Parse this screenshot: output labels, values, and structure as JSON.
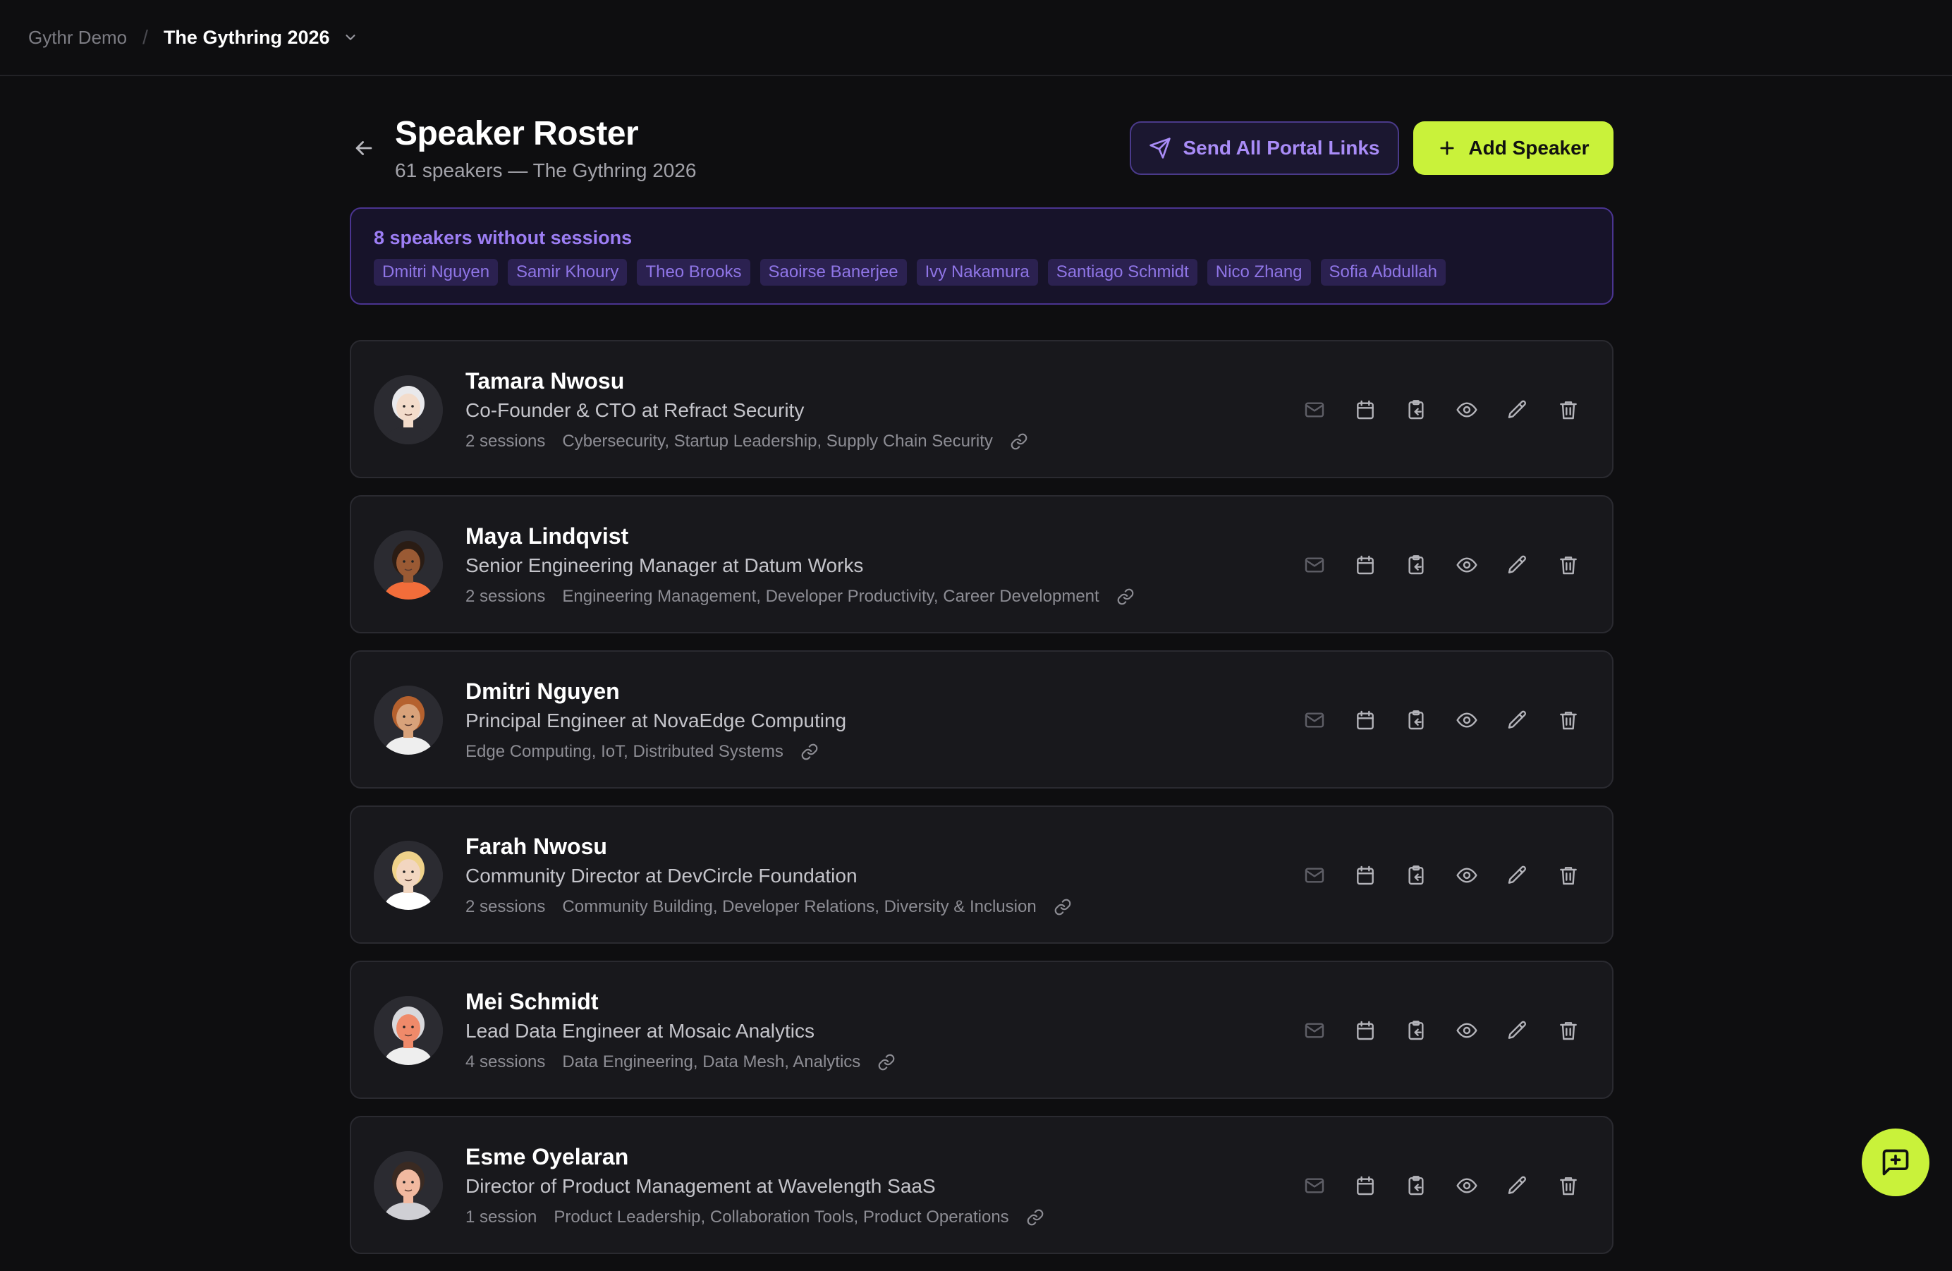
{
  "breadcrumb": {
    "org": "Gythr Demo",
    "separator": "/",
    "event": "The Gythring 2026"
  },
  "header": {
    "title": "Speaker Roster",
    "subtitle": "61 speakers — The Gythring 2026",
    "send_label": "Send All Portal Links",
    "add_label": "Add Speaker"
  },
  "notice": {
    "title": "8 speakers without sessions",
    "names": [
      "Dmitri Nguyen",
      "Samir Khoury",
      "Theo Brooks",
      "Saoirse Banerjee",
      "Ivy Nakamura",
      "Santiago Schmidt",
      "Nico Zhang",
      "Sofia Abdullah"
    ]
  },
  "speakers": [
    {
      "name": "Tamara Nwosu",
      "title": "Co-Founder & CTO at Refract Security",
      "sessions": "2 sessions",
      "topics": "Cybersecurity, Startup Leadership, Supply Chain Security",
      "avatar": {
        "skin": "#f3dccb",
        "hair": "#e9e9ec",
        "shirt": "#2b2b31"
      }
    },
    {
      "name": "Maya Lindqvist",
      "title": "Senior Engineering Manager at Datum Works",
      "sessions": "2 sessions",
      "topics": "Engineering Management, Developer Productivity, Career Development",
      "avatar": {
        "skin": "#9a5a34",
        "hair": "#2a1c14",
        "shirt": "#f26d3a"
      }
    },
    {
      "name": "Dmitri Nguyen",
      "title": "Principal Engineer at NovaEdge Computing",
      "sessions": "",
      "topics": "Edge Computing, IoT, Distributed Systems",
      "avatar": {
        "skin": "#d8a27a",
        "hair": "#b5612e",
        "shirt": "#eeeeee"
      }
    },
    {
      "name": "Farah Nwosu",
      "title": "Community Director at DevCircle Foundation",
      "sessions": "2 sessions",
      "topics": "Community Building, Developer Relations, Diversity & Inclusion",
      "avatar": {
        "skin": "#f2d6c0",
        "hair": "#efd28a",
        "shirt": "#ffffff"
      }
    },
    {
      "name": "Mei Schmidt",
      "title": "Lead Data Engineer at Mosaic Analytics",
      "sessions": "4 sessions",
      "topics": "Data Engineering, Data Mesh, Analytics",
      "avatar": {
        "skin": "#ef8a6a",
        "hair": "#d8d8dc",
        "shirt": "#eeeeee"
      }
    },
    {
      "name": "Esme Oyelaran",
      "title": "Director of Product Management at Wavelength SaaS",
      "sessions": "1 session",
      "topics": "Product Leadership, Collaboration Tools, Product Operations",
      "avatar": {
        "skin": "#f1b9a0",
        "hair": "#3a2a22",
        "shirt": "#cfcfd4"
      }
    }
  ],
  "icons": {
    "email": "mail-icon",
    "schedule": "calendar-icon",
    "copy": "clipboard-icon",
    "preview": "eye-icon",
    "edit": "pencil-icon",
    "delete": "trash-icon",
    "portal": "link-icon",
    "feedback": "message-plus-icon"
  },
  "colors": {
    "accent": "#c9f23a",
    "purple": "#9d7ef5",
    "background": "#0e0e10",
    "card": "#18181c"
  }
}
